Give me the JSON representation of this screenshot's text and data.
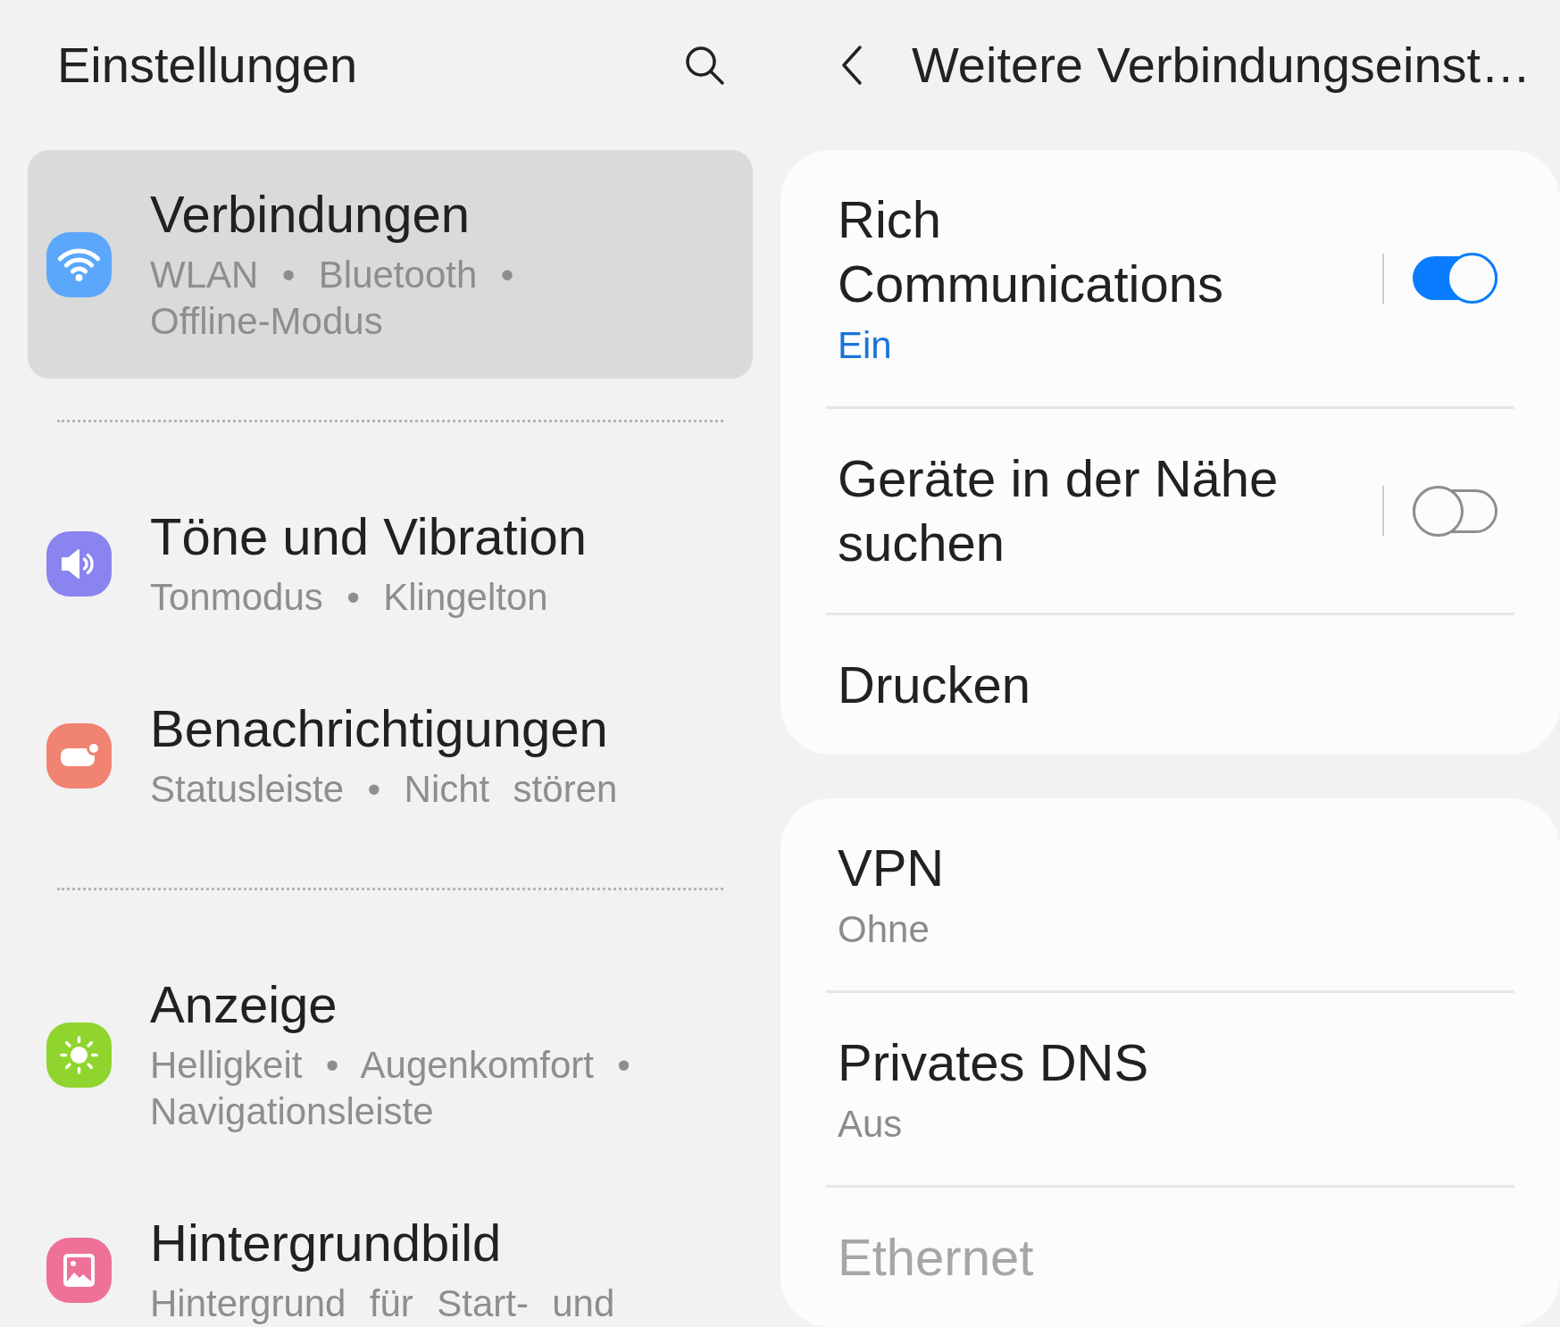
{
  "left_panel": {
    "title": "Einstellungen",
    "groups": [
      {
        "items": [
          {
            "kind": "connections",
            "color": "#5aa7fc",
            "title": "Verbindungen",
            "subtitle": "WLAN • Bluetooth • Offline-Modus",
            "selected": true
          }
        ]
      },
      {
        "items": [
          {
            "kind": "sounds",
            "color": "#8a84f1",
            "title": "Töne und Vibration",
            "subtitle": "Tonmodus • Klingelton",
            "selected": false
          },
          {
            "kind": "notifications",
            "color": "#f18373",
            "title": "Benachrichtigungen",
            "subtitle": "Statusleiste • Nicht stören",
            "selected": false
          }
        ]
      },
      {
        "items": [
          {
            "kind": "display",
            "color": "#8fd52e",
            "title": "Anzeige",
            "subtitle": "Helligkeit • Augenkomfort • Navigationsleiste",
            "selected": false
          },
          {
            "kind": "wallpaper",
            "color": "#ee7198",
            "title": "Hintergrundbild",
            "subtitle": "Hintergrund für Start- und",
            "selected": false
          }
        ]
      }
    ]
  },
  "right_panel": {
    "title": "Weitere Verbindungseinst…",
    "cards": [
      {
        "rows": [
          {
            "kind": "toggle",
            "title": "Rich Communications",
            "summary": "Ein",
            "on": true,
            "disabled": false
          },
          {
            "kind": "toggle",
            "title": "Geräte in der Nähe suchen",
            "on": false,
            "disabled": false
          },
          {
            "kind": "link",
            "title": "Drucken",
            "disabled": false
          }
        ]
      },
      {
        "rows": [
          {
            "kind": "link",
            "title": "VPN",
            "summary": "Ohne",
            "disabled": false
          },
          {
            "kind": "link",
            "title": "Privates DNS",
            "summary": "Aus",
            "disabled": false
          },
          {
            "kind": "link",
            "title": "Ethernet",
            "disabled": true
          }
        ]
      }
    ]
  }
}
